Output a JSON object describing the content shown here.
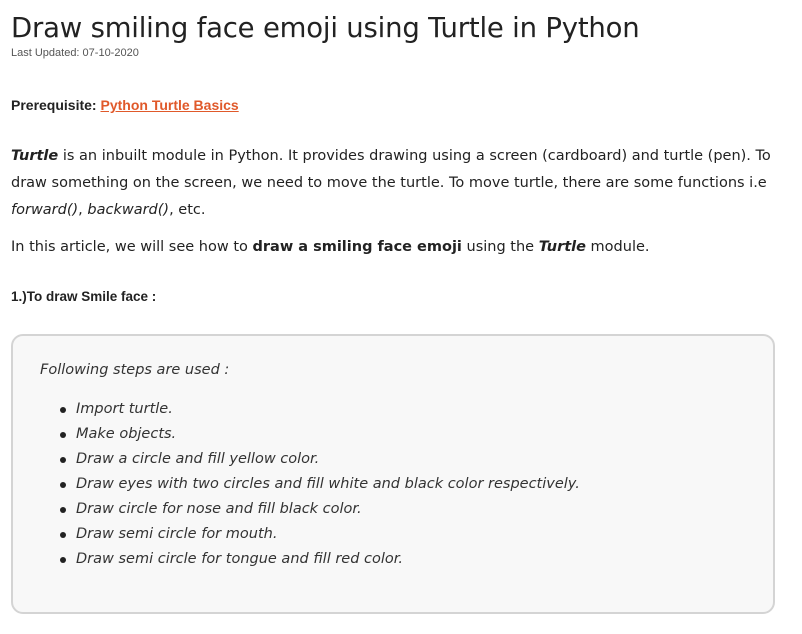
{
  "article": {
    "title": "Draw smiling face emoji using Turtle in Python",
    "last_updated": "Last Updated: 07-10-2020",
    "prerequisite": {
      "label": "Prerequisite: ",
      "link_text": "Python Turtle Basics"
    },
    "intro": {
      "turtle_word": "Turtle",
      "text_1": " is an inbuilt module in Python. It provides drawing using a screen (cardboard) and turtle (pen). To draw something on the screen, we need to move the turtle. To move turtle, there are some functions i.e ",
      "func_forward": "forward()",
      "comma": ", ",
      "func_backward": "backward()",
      "text_end": ", etc."
    },
    "summary": {
      "text_1": "In this article, we will see how to ",
      "bold_phrase": "draw a smiling face emoji",
      "text_2": " using the ",
      "turtle_word": "Turtle",
      "text_3": " module."
    },
    "section_heading": "1.)To draw Smile face :",
    "steps": {
      "intro": "Following steps are used :",
      "items": [
        "Import turtle.",
        "Make objects.",
        "Draw a circle and fill yellow color.",
        "Draw eyes with two circles and fill white and black color respectively.",
        "Draw circle for nose and fill black color.",
        "Draw semi circle for mouth.",
        "Draw semi circle for tongue and fill red color."
      ]
    }
  },
  "colors": {
    "link": "#e0592a",
    "box_background": "#f8f8f8",
    "box_border": "#d4d4d4",
    "text": "#222222"
  }
}
